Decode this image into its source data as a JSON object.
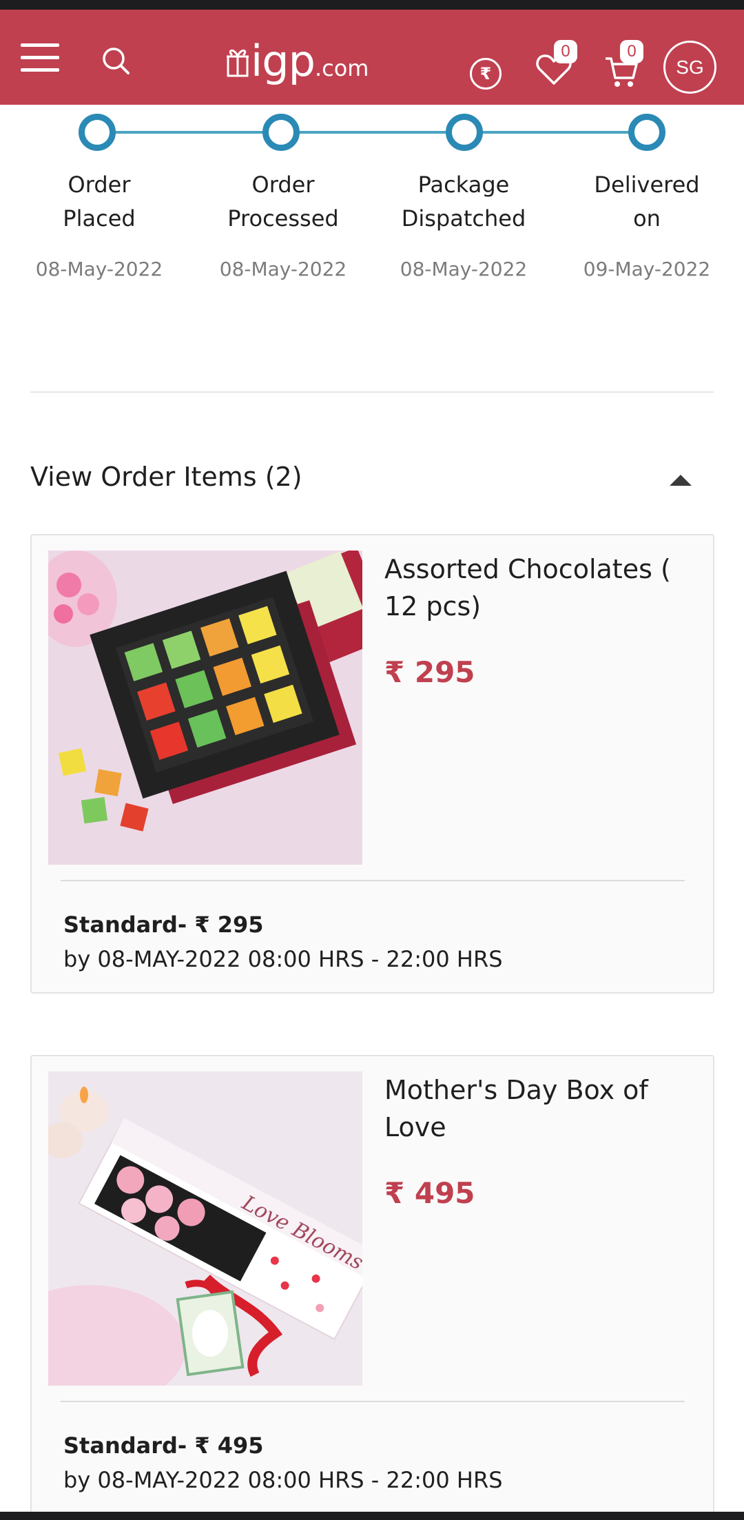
{
  "header": {
    "logo_main": "igp",
    "logo_suffix": ".com",
    "currency_symbol": "₹",
    "wishlist_count": "0",
    "cart_count": "0",
    "user_initials": "SG",
    "brand_color": "#c0404f"
  },
  "tracker": {
    "accent_color": "#2a8ab5",
    "steps": [
      {
        "line1": "Order",
        "line2": "Placed",
        "date": "08-May-2022"
      },
      {
        "line1": "Order",
        "line2": "Processed",
        "date": "08-May-2022"
      },
      {
        "line1": "Package",
        "line2": "Dispatched",
        "date": "08-May-2022"
      },
      {
        "line1": "Delivered",
        "line2": "on",
        "date": "09-May-2022"
      }
    ]
  },
  "order_items": {
    "title": "View Order Items (2)",
    "toggle_icon": "caret-up-icon",
    "items": [
      {
        "name": "Assorted Chocolates ( 12 pcs)",
        "price": "₹ 295",
        "shipping_title": "Standard- ₹ 295",
        "shipping_window": "by 08-MAY-2022 08:00 HRS - 22:00 HRS",
        "image_icon": "chocolate-box-image"
      },
      {
        "name": "Mother's Day Box of Love",
        "price": "₹ 495",
        "shipping_title": "Standard- ₹ 495",
        "shipping_window": "by 08-MAY-2022 08:00 HRS - 22:00 HRS",
        "image_icon": "rose-box-image"
      }
    ]
  }
}
